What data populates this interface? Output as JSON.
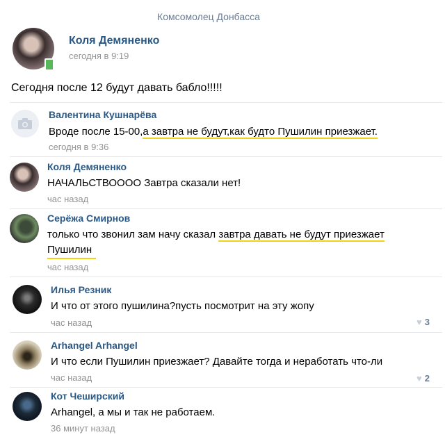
{
  "group": {
    "name": "Комсомолец Донбасса"
  },
  "post": {
    "author": "Коля Демяненко",
    "time": "сегодня в 9:19",
    "text": "Сегодня после 12 будут давать бабло!!!!!"
  },
  "comments": [
    {
      "author": "Валентина Кушнарёва",
      "text_before": "Вроде после 15-00,",
      "text_highlight": "а завтра не будут,как будто Пушилин приезжает.",
      "time": "сегодня в 9:36"
    },
    {
      "author": "Коля Демяненко",
      "text": "НАЧАЛЬСТВОООО  Завтра сказали нет!",
      "time": "час назад"
    },
    {
      "author": "Серёжа Смирнов",
      "text_before": "только что звонил зам начу сказал ",
      "text_highlight": "завтра давать не будут приезжает",
      "text_line2": "Пушилин",
      "time": "час назад"
    },
    {
      "author": "Илья Резник",
      "text": "И что от этого пушилина?пусть посмотрит на эту жопу",
      "time": "час назад",
      "likes": "3"
    },
    {
      "author": "Arhangel Arhangel",
      "text": "И что если Пушилин приезжает? Давайте тогда и неработать что-ли",
      "time": "час назад",
      "likes": "2"
    },
    {
      "author": "Кот Чеширский",
      "text": "Arhangel, а мы и так не работаем.",
      "time": "36 минут назад"
    }
  ],
  "icons": {
    "like": "heart-icon",
    "placeholder": "camera-icon"
  },
  "colors": {
    "link": "#2a5885",
    "highlight": "#f0d21c",
    "muted": "#939393"
  }
}
